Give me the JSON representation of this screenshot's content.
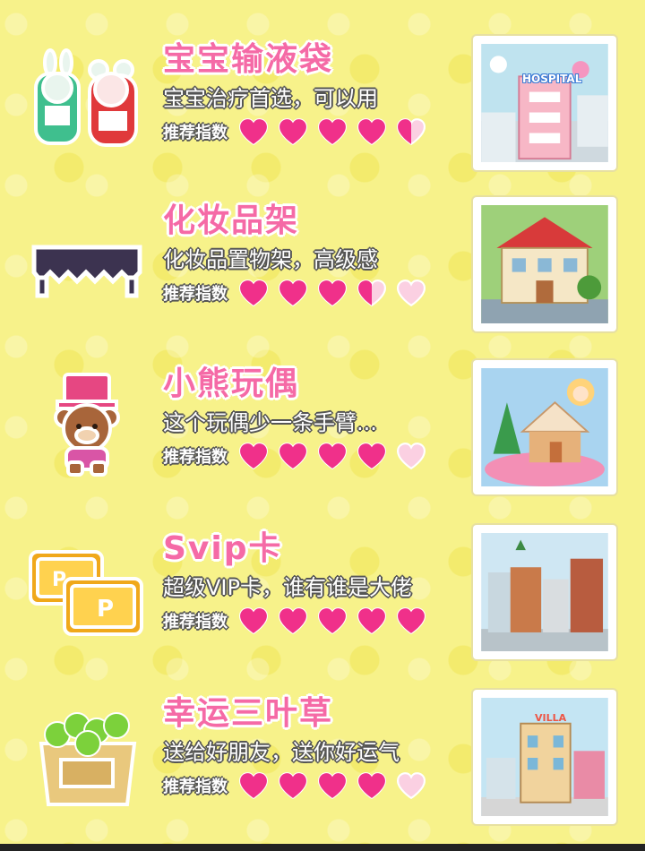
{
  "rating_label": "推荐指数",
  "colors": {
    "title_pink": "#f56aa6",
    "heart_full": "#f0308a",
    "heart_empty": "#fbd0e2",
    "background": "#f7f28a"
  },
  "items": [
    {
      "title": "宝宝输液袋",
      "description": "宝宝治疗首选，可以用",
      "rating": 4.5,
      "stamp": "hospital",
      "stamp_sign": "HOSPITAL",
      "icon": "iv-bag-bunny-bear-icon"
    },
    {
      "title": "化妆品架",
      "description": "化妆品置物架，高级感",
      "rating": 3.5,
      "stamp": "house",
      "icon": "cosmetic-shelf-icon"
    },
    {
      "title": "小熊玩偶",
      "description": "这个玩偶少一条手臂...",
      "rating": 4,
      "stamp": "christmas",
      "icon": "bear-doll-icon"
    },
    {
      "title": "Svip卡",
      "description": "超级VIP卡，谁有谁是大佬",
      "rating": 5,
      "stamp": "city",
      "icon": "svip-card-icon"
    },
    {
      "title": "幸运三叶草",
      "description": "送给好朋友，送你好运气",
      "rating": 4,
      "stamp": "villa",
      "stamp_sign": "VILLA",
      "icon": "clover-box-icon"
    }
  ]
}
